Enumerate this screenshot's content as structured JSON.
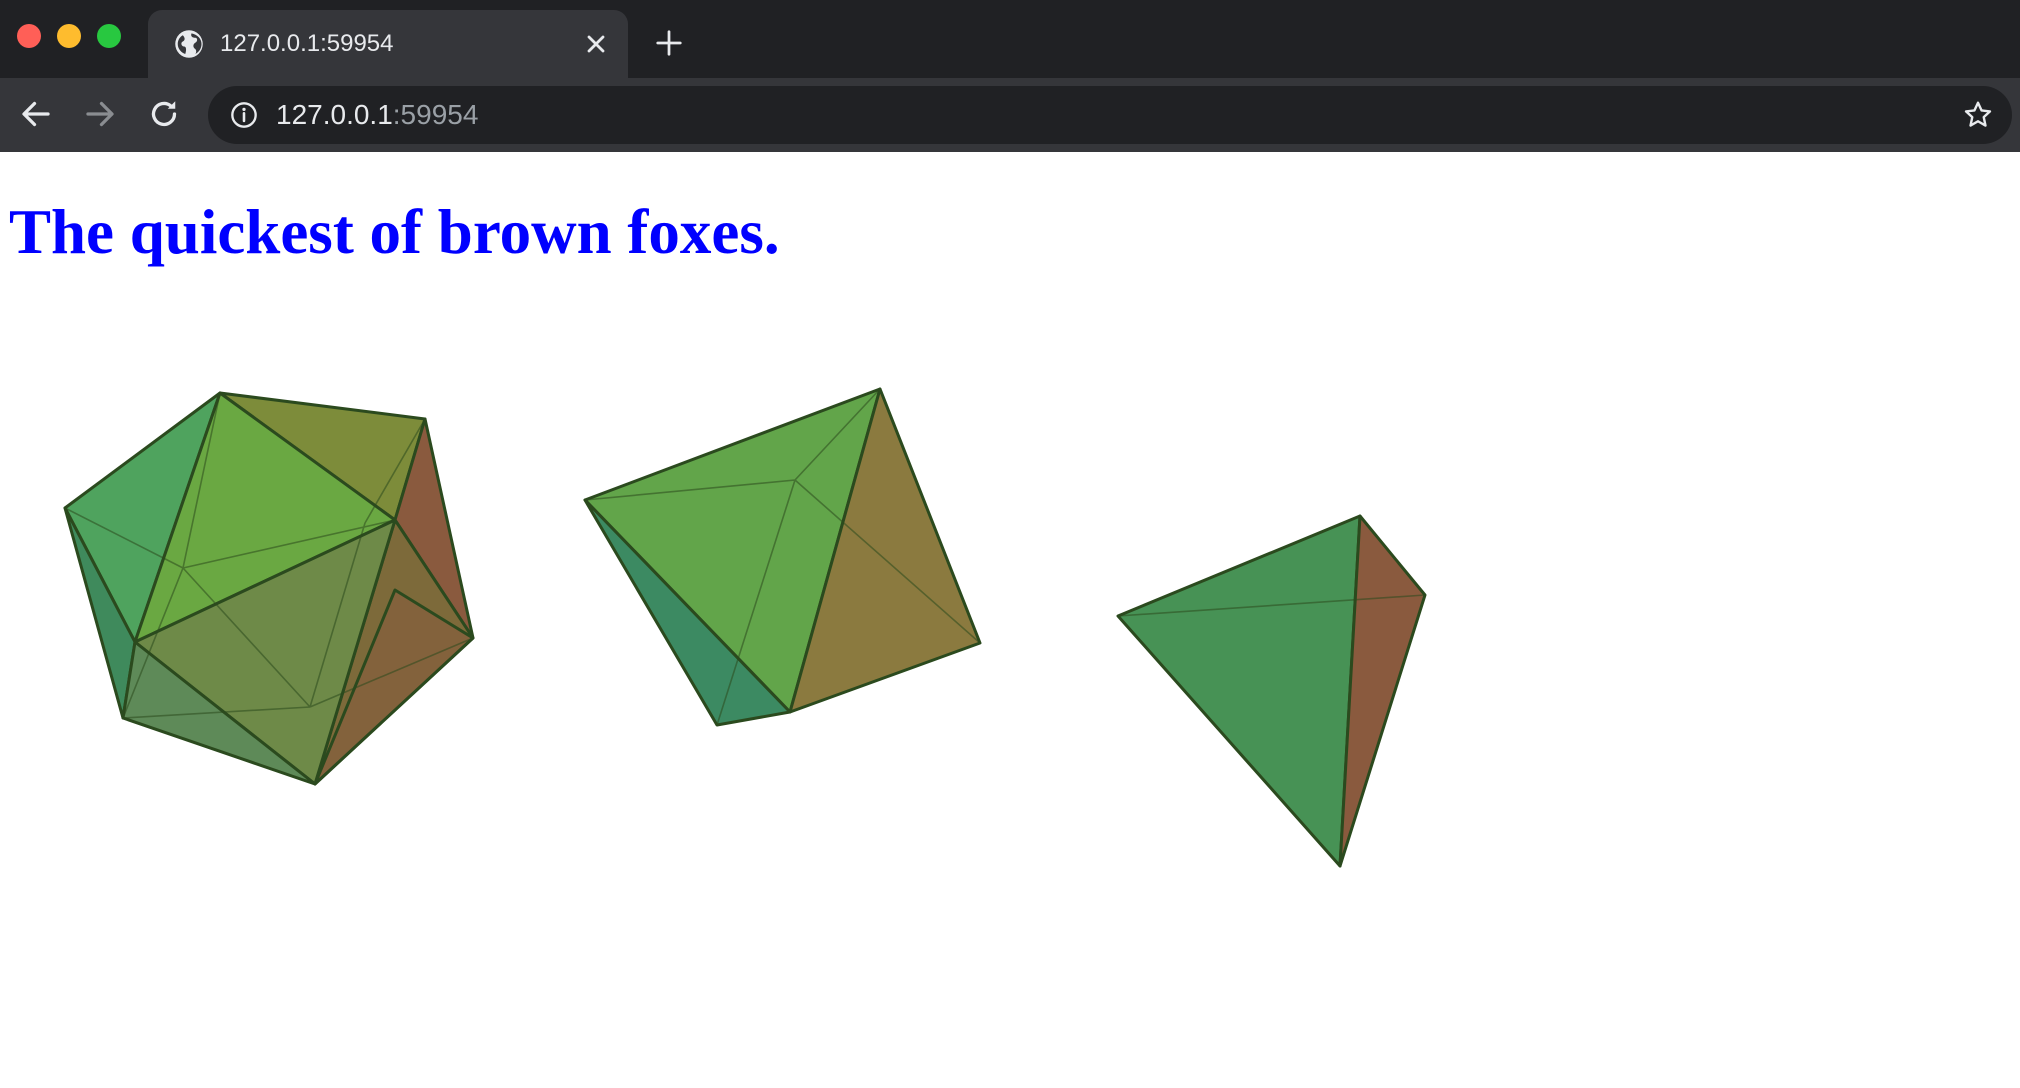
{
  "browser": {
    "tab": {
      "title": "127.0.0.1:59954",
      "favicon": "globe-icon"
    },
    "toolbar": {
      "back_icon": "back-arrow-icon",
      "forward_icon": "forward-arrow-icon",
      "reload_icon": "reload-icon",
      "url_host": "127.0.0.1",
      "url_port": ":59954",
      "bookmark_icon": "star-icon"
    }
  },
  "page": {
    "heading": "The quickest of brown foxes.",
    "heading_color": "#0000ff",
    "images": [
      {
        "shape": "icosahedron"
      },
      {
        "shape": "octahedron"
      },
      {
        "shape": "tetrahedron"
      }
    ]
  },
  "colors": {
    "chrome_dark": "#202124",
    "chrome_toolbar": "#35363a",
    "face_green": "#4fa35e",
    "face_olive": "#7d8c3a",
    "face_brown": "#8a5a3e",
    "edge": "#2b4a1e"
  }
}
